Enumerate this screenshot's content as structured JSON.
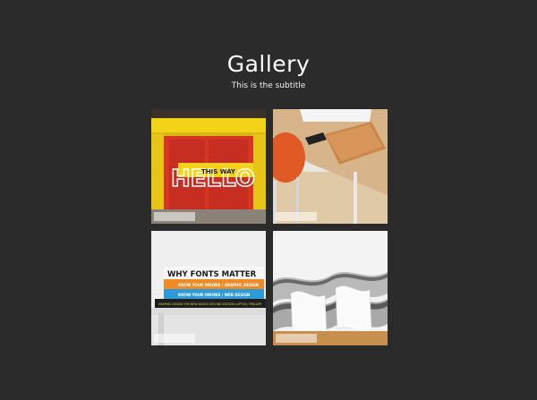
{
  "header": {
    "title": "Gallery",
    "subtitle": "This is the subtitle"
  },
  "gallery": {
    "items": [
      {
        "subject": "storefront-hello-sign",
        "caption": "",
        "sign_text": "HELLO",
        "banner_text": "THIS WAY"
      },
      {
        "subject": "desk-with-notebook-and-chair",
        "caption": ""
      },
      {
        "subject": "book-stack",
        "caption": "",
        "book_title": "WHY FONTS MATTER",
        "spine_1": "KNOW YOUR ONIONS / GRAPHIC DESIGN",
        "spine_2": "KNOW YOUR ONIONS / WEB DESIGN",
        "spine_3": "GRAPHIC DESIGN THE NEW BASICS  SECOND EDITION   LUPTON / PHILLIPS"
      },
      {
        "subject": "wavy-bookshelves",
        "caption": ""
      }
    ]
  },
  "colors": {
    "background": "#2b2b2b",
    "text": "#ffffff"
  }
}
